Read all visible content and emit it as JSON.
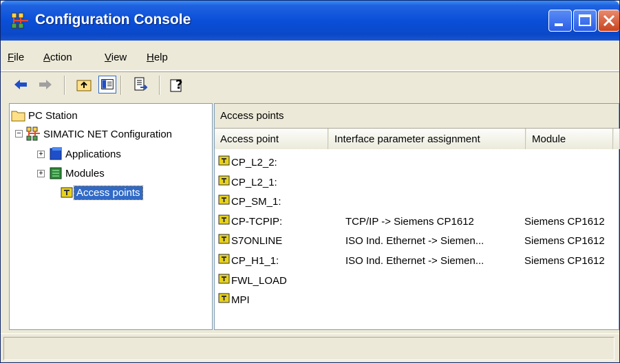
{
  "window": {
    "title": "Configuration Console"
  },
  "menu": [
    "File",
    "Action",
    "View",
    "Help"
  ],
  "menu_underline": [
    "F",
    "A",
    "V",
    "H"
  ],
  "tree": {
    "root": "PC Station",
    "config": "SIMATIC NET Configuration",
    "items": [
      "Applications",
      "Modules",
      "Access points"
    ]
  },
  "right": {
    "header": "Access points",
    "columns": [
      "Access point",
      "Interface parameter assignment",
      "Module"
    ],
    "rows": [
      {
        "name": "CP_L2_2:",
        "assignment": "",
        "module": ""
      },
      {
        "name": "CP_L2_1:",
        "assignment": "",
        "module": ""
      },
      {
        "name": "CP_SM_1:",
        "assignment": "",
        "module": ""
      },
      {
        "name": "CP-TCPIP:",
        "assignment": "TCP/IP -> Siemens CP1612",
        "module": "Siemens CP1612"
      },
      {
        "name": "S7ONLINE",
        "assignment": "ISO Ind. Ethernet -> Siemen...",
        "module": "Siemens CP1612"
      },
      {
        "name": "CP_H1_1:",
        "assignment": "ISO Ind. Ethernet -> Siemen...",
        "module": "Siemens CP1612"
      },
      {
        "name": "FWL_LOAD",
        "assignment": "",
        "module": ""
      },
      {
        "name": "MPI",
        "assignment": "",
        "module": ""
      }
    ]
  },
  "colors": {
    "titlebar": "#0a4fd8",
    "selection": "#316ac5",
    "chrome": "#ece9d8"
  },
  "icons": {
    "app": "network-config-icon",
    "toolbar": [
      "back-arrow-icon",
      "forward-arrow-icon",
      "folder-up-icon",
      "show-hide-tree-icon",
      "export-list-icon",
      "help-icon"
    ]
  }
}
